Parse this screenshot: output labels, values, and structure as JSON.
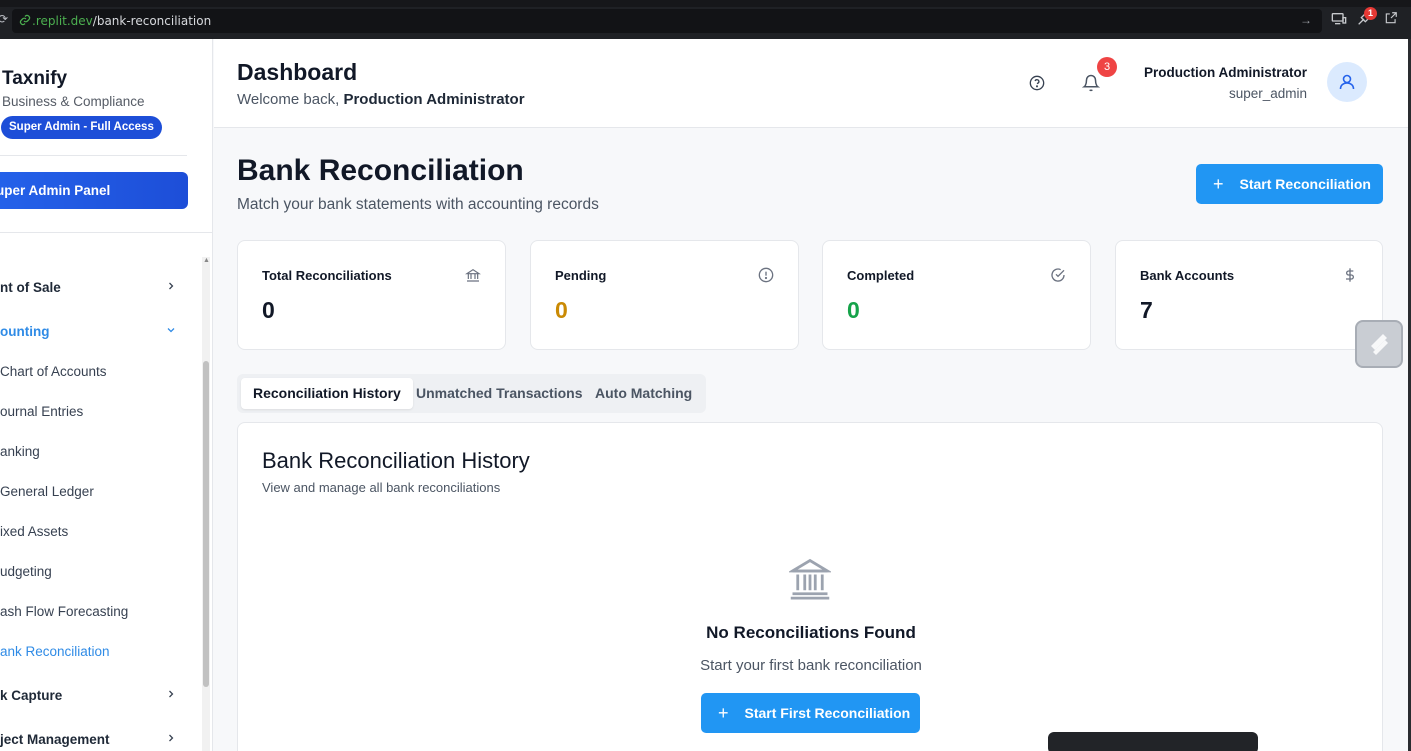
{
  "browser": {
    "url_host": ".replit.dev",
    "url_path": "/bank-reconciliation",
    "notification_badge": "1"
  },
  "sidebar": {
    "brand_name": "Taxnify",
    "brand_sub": "Business & Compliance",
    "role_badge": "Super Admin - Full Access",
    "admin_panel": "uper Admin Panel",
    "items": [
      {
        "label": "nt of Sale",
        "section": true,
        "chevron": "›"
      },
      {
        "label": "ounting",
        "section": true,
        "chevron": "⌄",
        "active": true
      },
      {
        "label": "Chart of Accounts"
      },
      {
        "label": "ournal Entries"
      },
      {
        "label": "anking"
      },
      {
        "label": "General Ledger"
      },
      {
        "label": "ixed Assets"
      },
      {
        "label": "udgeting"
      },
      {
        "label": "ash Flow Forecasting"
      },
      {
        "label": "ank Reconciliation",
        "active": true
      },
      {
        "label": "k Capture",
        "section": true,
        "chevron": "›"
      },
      {
        "label": "ject Management",
        "section": true,
        "chevron": "›"
      }
    ]
  },
  "header": {
    "title": "Dashboard",
    "welcome_prefix": "Welcome back, ",
    "welcome_name": "Production Administrator",
    "notification_count": "3",
    "user_name": "Production Administrator",
    "user_role": "super_admin"
  },
  "page": {
    "title": "Bank Reconciliation",
    "subtitle": "Match your bank statements with accounting records",
    "start_button": "Start Reconciliation"
  },
  "stats": [
    {
      "label": "Total Reconciliations",
      "value": "0",
      "icon": "bank-icon",
      "color": "#111827"
    },
    {
      "label": "Pending",
      "value": "0",
      "icon": "alert-circle-icon",
      "color": "#ca8a04"
    },
    {
      "label": "Completed",
      "value": "0",
      "icon": "check-circle-icon",
      "color": "#16a34a"
    },
    {
      "label": "Bank Accounts",
      "value": "7",
      "icon": "dollar-icon",
      "color": "#111827"
    }
  ],
  "tabs": [
    {
      "label": "Reconciliation History",
      "active": true
    },
    {
      "label": "Unmatched Transactions"
    },
    {
      "label": "Auto Matching"
    }
  ],
  "panel": {
    "title": "Bank Reconciliation History",
    "subtitle": "View and manage all bank reconciliations",
    "empty_title": "No Reconciliations Found",
    "empty_sub": "Start your first bank reconciliation",
    "empty_button": "Start First Reconciliation"
  },
  "colors": {
    "primary": "#2196f3",
    "active_nav": "#2f8be6",
    "badge_red": "#ef4444"
  }
}
